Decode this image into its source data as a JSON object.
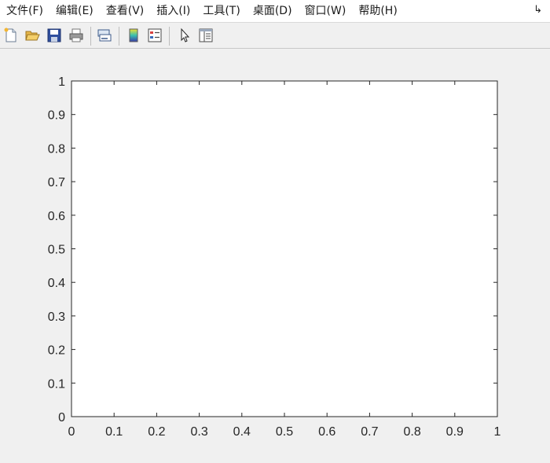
{
  "menubar": {
    "items": [
      "文件(F)",
      "编辑(E)",
      "查看(V)",
      "插入(I)",
      "工具(T)",
      "桌面(D)",
      "窗口(W)",
      "帮助(H)"
    ],
    "end_icon": "dock-arrow-icon"
  },
  "toolbar": {
    "tools": [
      {
        "name": "new-figure-icon"
      },
      {
        "name": "open-file-icon"
      },
      {
        "name": "save-icon"
      },
      {
        "name": "print-icon"
      },
      {
        "name": "link-plot-icon"
      },
      {
        "name": "insert-colorbar-icon"
      },
      {
        "name": "insert-legend-icon"
      },
      {
        "name": "edit-plot-arrow-icon"
      },
      {
        "name": "property-inspector-icon"
      }
    ]
  },
  "chart_data": {
    "type": "line",
    "series": [],
    "xlim": [
      0,
      1
    ],
    "ylim": [
      0,
      1
    ],
    "xticks": [
      "0",
      "0.1",
      "0.2",
      "0.3",
      "0.4",
      "0.5",
      "0.6",
      "0.7",
      "0.8",
      "0.9",
      "1"
    ],
    "yticks": [
      "0",
      "0.1",
      "0.2",
      "0.3",
      "0.4",
      "0.5",
      "0.6",
      "0.7",
      "0.8",
      "0.9",
      "1"
    ],
    "grid": false,
    "box": true
  }
}
